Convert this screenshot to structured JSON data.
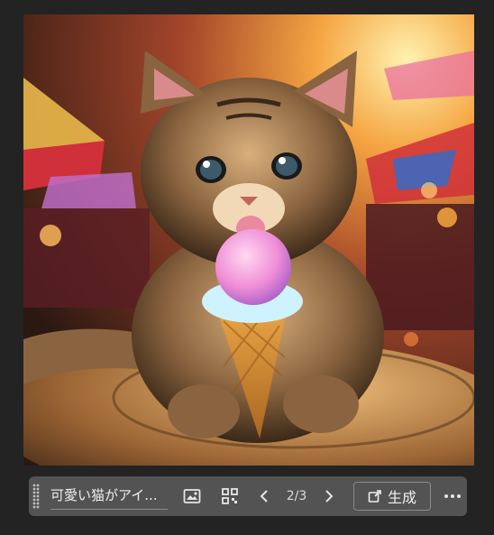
{
  "image": {
    "alt_icon": "generated-image"
  },
  "toolbar": {
    "prompt_text": "可愛い猫がアイ...",
    "page_indicator": "2/3",
    "generate_label": "生成",
    "icons": [
      "drag-handle-icon",
      "image-reference-icon",
      "qr-variations-icon",
      "chevron-left-icon",
      "chevron-right-icon",
      "generate-icon",
      "more-icon"
    ]
  }
}
